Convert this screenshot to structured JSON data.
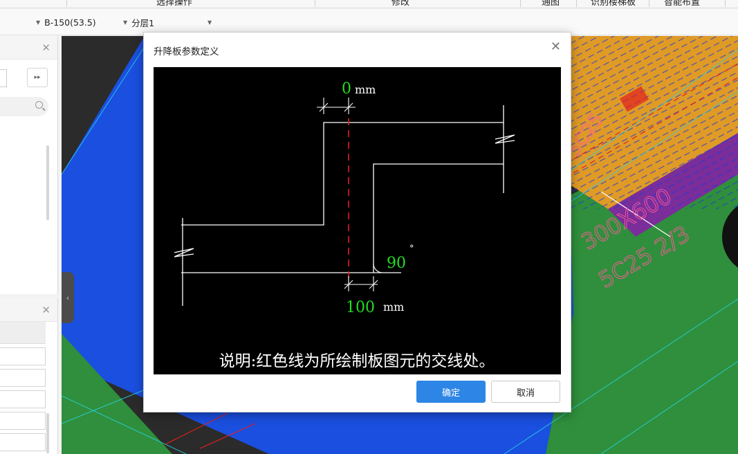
{
  "ribbon": {
    "cut_labels": [
      "选择操作",
      "修改",
      "通图",
      "识别楼梯板",
      "智能布置"
    ]
  },
  "toolbar": {
    "spec_combo": "B-150(53.5)",
    "layer_combo": "分层1"
  },
  "dialog": {
    "title": "升降板参数定义",
    "top_offset_value": "0",
    "top_offset_unit": "mm",
    "angle_value": "90",
    "angle_unit": "°",
    "bottom_offset_value": "100",
    "bottom_offset_unit": "mm",
    "note": "说明:红色线为所绘制板图元的交线处。",
    "ok_label": "确定",
    "cancel_label": "取消"
  },
  "viewport": {
    "labels": [
      "300X600",
      "5C25 2/3",
      "5C25"
    ]
  },
  "colors": {
    "accent_blue": "#2d86e6",
    "dim_green": "#22dd22",
    "intersection_red": "#e02020",
    "slab_blue": "#1a4fe0",
    "beam_orange": "#e09a26",
    "ground_green": "#2f8f3c",
    "beam_purple": "#7b2d9a"
  },
  "icons": [
    "close-icon",
    "search-icon",
    "double-arrow-icon",
    "chevron-left-icon",
    "dropdown-arrow-icon"
  ]
}
